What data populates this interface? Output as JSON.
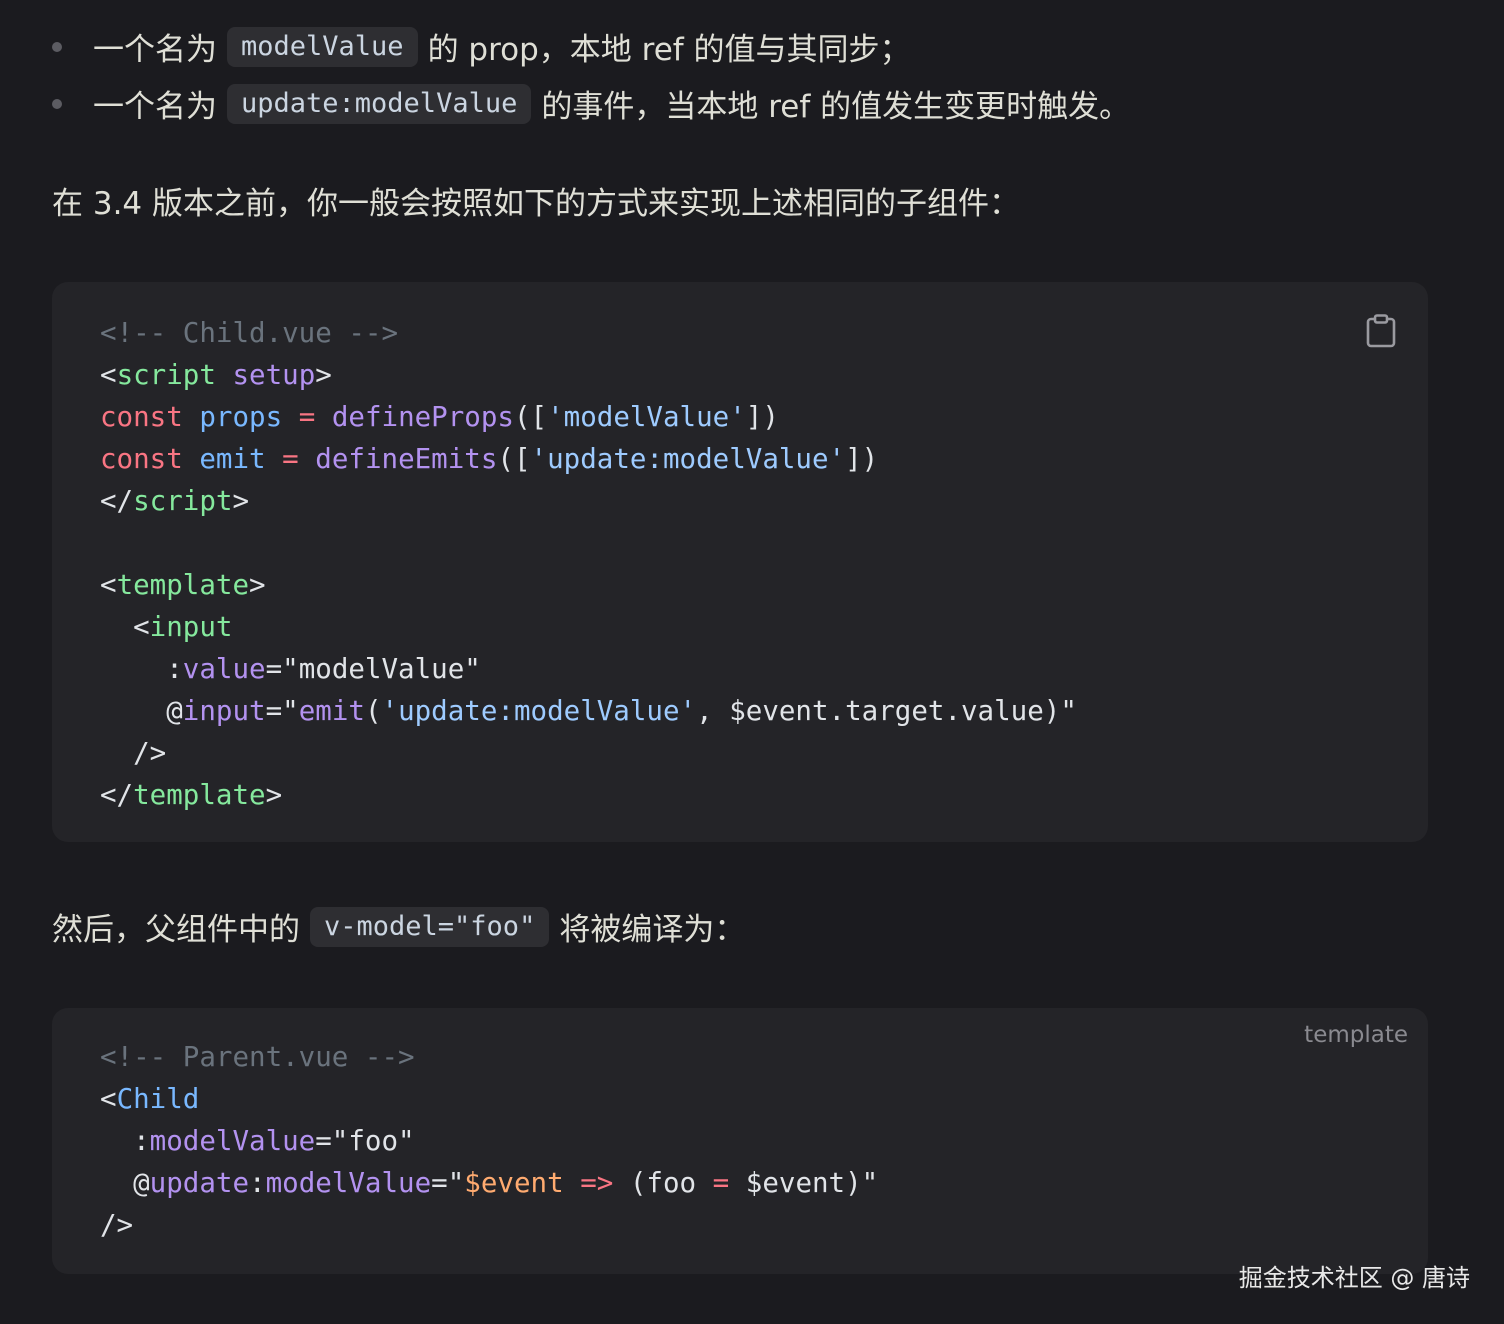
{
  "bullets": [
    {
      "before": "一个名为",
      "code": "modelValue",
      "after": "的 prop，本地 ref 的值与其同步；"
    },
    {
      "before": "一个名为",
      "code": "update:modelValue",
      "after": "的事件，当本地 ref 的值发生变更时触发。"
    }
  ],
  "paragraph1": "在 3.4 版本之前，你一般会按照如下的方式来实现上述相同的子组件：",
  "code1": {
    "copy_icon": "clipboard-icon",
    "lines": [
      [
        {
          "c": "t-comment",
          "t": "<!-- Child.vue -->"
        }
      ],
      [
        {
          "c": "t-punct",
          "t": "<"
        },
        {
          "c": "t-tag",
          "t": "script"
        },
        {
          "c": "t-plain",
          "t": " "
        },
        {
          "c": "t-attr",
          "t": "setup"
        },
        {
          "c": "t-punct",
          "t": ">"
        }
      ],
      [
        {
          "c": "t-keyword",
          "t": "const"
        },
        {
          "c": "t-plain",
          "t": " "
        },
        {
          "c": "t-var",
          "t": "props"
        },
        {
          "c": "t-plain",
          "t": " "
        },
        {
          "c": "t-op",
          "t": "="
        },
        {
          "c": "t-plain",
          "t": " "
        },
        {
          "c": "t-func",
          "t": "defineProps"
        },
        {
          "c": "t-plain",
          "t": "(["
        },
        {
          "c": "t-string",
          "t": "'modelValue'"
        },
        {
          "c": "t-plain",
          "t": "])"
        }
      ],
      [
        {
          "c": "t-keyword",
          "t": "const"
        },
        {
          "c": "t-plain",
          "t": " "
        },
        {
          "c": "t-var",
          "t": "emit"
        },
        {
          "c": "t-plain",
          "t": " "
        },
        {
          "c": "t-op",
          "t": "="
        },
        {
          "c": "t-plain",
          "t": " "
        },
        {
          "c": "t-func",
          "t": "defineEmits"
        },
        {
          "c": "t-plain",
          "t": "(["
        },
        {
          "c": "t-string",
          "t": "'update:modelValue'"
        },
        {
          "c": "t-plain",
          "t": "])"
        }
      ],
      [
        {
          "c": "t-punct",
          "t": "</"
        },
        {
          "c": "t-tag",
          "t": "script"
        },
        {
          "c": "t-punct",
          "t": ">"
        }
      ],
      [],
      [
        {
          "c": "t-punct",
          "t": "<"
        },
        {
          "c": "t-tag",
          "t": "template"
        },
        {
          "c": "t-punct",
          "t": ">"
        }
      ],
      [
        {
          "c": "t-plain",
          "t": "  <"
        },
        {
          "c": "t-tag",
          "t": "input"
        }
      ],
      [
        {
          "c": "t-plain",
          "t": "    :"
        },
        {
          "c": "t-attr",
          "t": "value"
        },
        {
          "c": "t-plain",
          "t": "=\"modelValue\""
        }
      ],
      [
        {
          "c": "t-plain",
          "t": "    @"
        },
        {
          "c": "t-attr",
          "t": "input"
        },
        {
          "c": "t-plain",
          "t": "=\""
        },
        {
          "c": "t-func",
          "t": "emit"
        },
        {
          "c": "t-plain",
          "t": "("
        },
        {
          "c": "t-string",
          "t": "'update:modelValue'"
        },
        {
          "c": "t-plain",
          "t": ", $event.target.value)\""
        }
      ],
      [
        {
          "c": "t-plain",
          "t": "  />"
        }
      ],
      [
        {
          "c": "t-punct",
          "t": "</"
        },
        {
          "c": "t-tag",
          "t": "template"
        },
        {
          "c": "t-punct",
          "t": ">"
        }
      ]
    ]
  },
  "paragraph2": {
    "before": "然后，父组件中的",
    "code": "v-model=\"foo\"",
    "after": "将被编译为："
  },
  "code2": {
    "lang": "template",
    "lines": [
      [
        {
          "c": "t-comment",
          "t": "<!-- Parent.vue -->"
        }
      ],
      [
        {
          "c": "t-punct",
          "t": "<"
        },
        {
          "c": "t-blue",
          "t": "Child"
        }
      ],
      [
        {
          "c": "t-plain",
          "t": "  :"
        },
        {
          "c": "t-attr",
          "t": "modelValue"
        },
        {
          "c": "t-plain",
          "t": "=\"foo\""
        }
      ],
      [
        {
          "c": "t-plain",
          "t": "  @"
        },
        {
          "c": "t-attr",
          "t": "update"
        },
        {
          "c": "t-plain",
          "t": ":"
        },
        {
          "c": "t-attr",
          "t": "modelValue"
        },
        {
          "c": "t-plain",
          "t": "=\""
        },
        {
          "c": "t-orange",
          "t": "$event"
        },
        {
          "c": "t-plain",
          "t": " "
        },
        {
          "c": "t-op",
          "t": "=>"
        },
        {
          "c": "t-plain",
          "t": " (foo "
        },
        {
          "c": "t-op",
          "t": "="
        },
        {
          "c": "t-plain",
          "t": " $event)\""
        }
      ],
      [
        {
          "c": "t-plain",
          "t": "/>"
        }
      ]
    ]
  },
  "watermark": "掘金技术社区 @ 唐诗"
}
